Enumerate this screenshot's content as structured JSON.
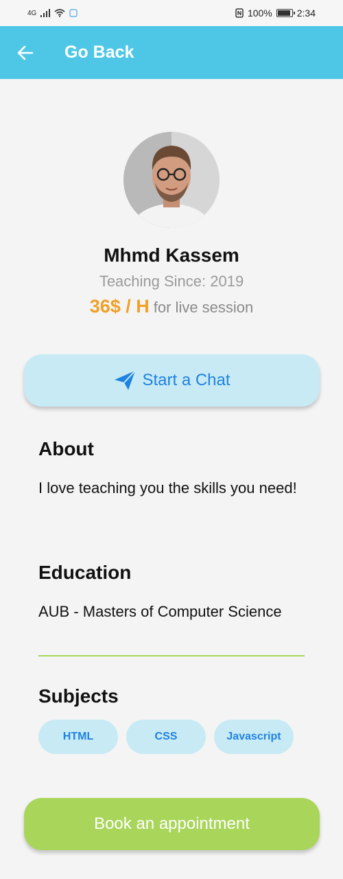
{
  "status": {
    "network": "4G",
    "battery": "100%",
    "time": "2:34"
  },
  "header": {
    "title": "Go Back"
  },
  "profile": {
    "name": "Mhmd Kassem",
    "teaching_since": "Teaching Since: 2019",
    "price": "36$ / H",
    "price_suffix": "for live session"
  },
  "actions": {
    "chat_label": "Start a Chat",
    "book_label": "Book an appointment"
  },
  "about": {
    "title": "About",
    "text": "I love teaching you the skills you need!"
  },
  "education": {
    "title": "Education",
    "text": "AUB - Masters of Computer Science"
  },
  "subjects": {
    "title": "Subjects",
    "items": [
      "HTML",
      "CSS",
      "Javascript"
    ]
  },
  "colors": {
    "header": "#4ec7e6",
    "accent_blue": "#1e82e0",
    "price_orange": "#f0a028",
    "book_green": "#a8d55a",
    "chip_bg": "#c8eaf5"
  }
}
